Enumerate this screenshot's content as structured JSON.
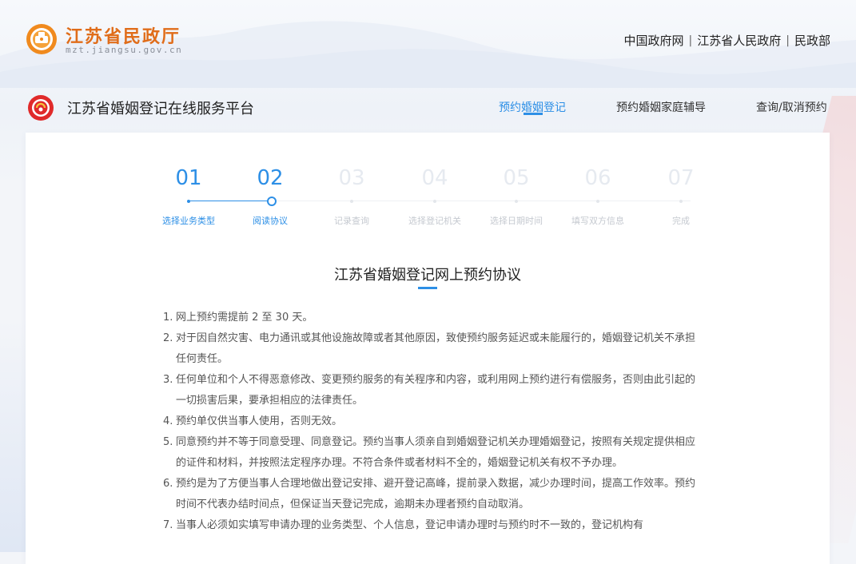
{
  "gov": {
    "name": "江苏省民政厅",
    "domain": "mzt.jiangsu.gov.cn",
    "links": [
      "中国政府网",
      "江苏省人民政府",
      "民政部"
    ]
  },
  "platform": {
    "title": "江苏省婚姻登记在线服务平台",
    "nav": [
      "预约婚姻登记",
      "预约婚姻家庭辅导",
      "查询/取消预约"
    ],
    "active_nav": "预约婚姻登记"
  },
  "steps": {
    "current": 2,
    "items": [
      {
        "num": "01",
        "label": "选择业务类型"
      },
      {
        "num": "02",
        "label": "阅读协议"
      },
      {
        "num": "03",
        "label": "记录查询"
      },
      {
        "num": "04",
        "label": "选择登记机关"
      },
      {
        "num": "05",
        "label": "选择日期时间"
      },
      {
        "num": "06",
        "label": "填写双方信息"
      },
      {
        "num": "07",
        "label": "完成"
      }
    ]
  },
  "agreement": {
    "title": "江苏省婚姻登记网上预约协议",
    "items": [
      {
        "num": "1.",
        "text": "网上预约需提前 2 至 30 天。"
      },
      {
        "num": "2.",
        "text": "对于因自然灾害、电力通讯或其他设施故障或者其他原因，致使预约服务延迟或未能履行的，婚姻登记机关不承担任何责任。"
      },
      {
        "num": "3.",
        "text": "任何单位和个人不得恶意修改、变更预约服务的有关程序和内容，或利用网上预约进行有偿服务，否则由此引起的一切损害后果，要承担相应的法律责任。"
      },
      {
        "num": "4.",
        "text": "预约单仅供当事人使用，否则无效。"
      },
      {
        "num": "5.",
        "text": "同意预约并不等于同意受理、同意登记。预约当事人须亲自到婚姻登记机关办理婚姻登记，按照有关规定提供相应的证件和材料，并按照法定程序办理。不符合条件或者材料不全的，婚姻登记机关有权不予办理。"
      },
      {
        "num": "6.",
        "text": "预约是为了方便当事人合理地做出登记安排、避开登记高峰，提前录入数据，减少办理时间，提高工作效率。预约时间不代表办结时间点，但保证当天登记完成，逾期未办理者预约自动取消。"
      },
      {
        "num": "7.",
        "text": "当事人必须如实填写申请办理的业务类型、个人信息，登记申请办理时与预约时不一致的，登记机构有"
      }
    ]
  },
  "colors": {
    "accent": "#2d8fe6",
    "brand_orange": "#e06d1a",
    "inactive_step": "#e6eaf0"
  }
}
